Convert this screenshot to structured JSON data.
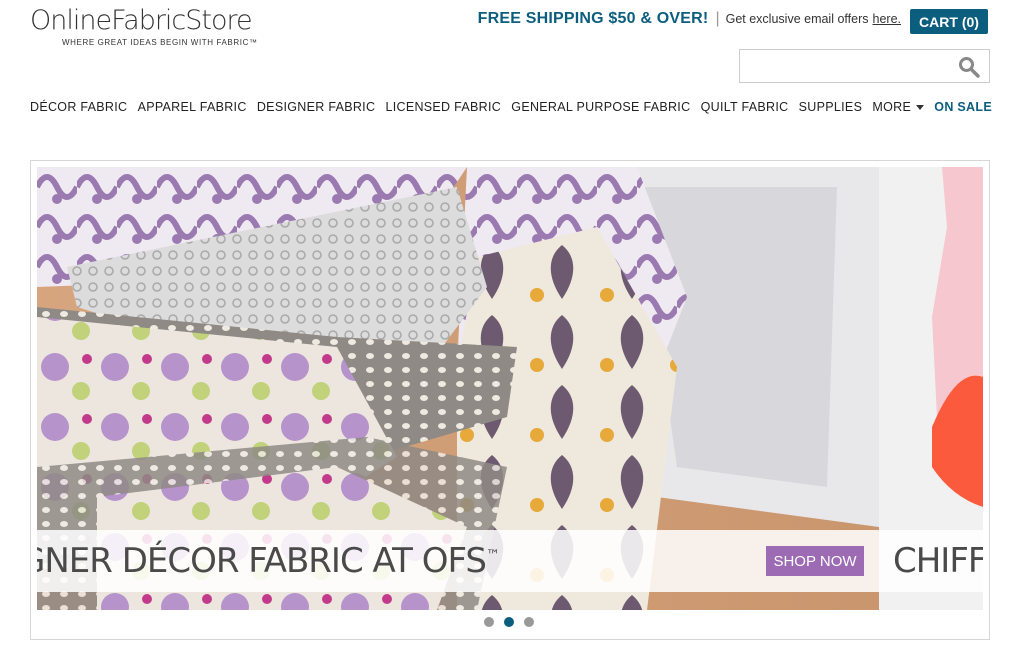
{
  "logo": {
    "name": "OnlineFabricStore",
    "tagline": "WHERE GREAT IDEAS BEGIN WITH FABRIC™"
  },
  "header": {
    "free_shipping": "FREE SHIPPING $50 & OVER!",
    "separator": "|",
    "email_offer_text": "Get exclusive email offers",
    "email_offer_link": "here.",
    "cart_label": "CART (0)"
  },
  "search": {
    "placeholder": "",
    "value": "",
    "icon": "search-icon"
  },
  "nav": {
    "items": [
      "DÉCOR FABRIC",
      "APPAREL FABRIC",
      "DESIGNER FABRIC",
      "LICENSED FABRIC",
      "GENERAL PURPOSE FABRIC",
      "QUILT FABRIC",
      "SUPPLIES",
      "MORE",
      "ON SALE"
    ]
  },
  "carousel": {
    "caption": "GNER DÉCOR FABRIC AT OFS",
    "caption_mark": "™",
    "button_label": "SHOP NOW",
    "next_caption": "CHIFF",
    "active_slide": 2,
    "slide_count": 3
  },
  "colors": {
    "brand_blue": "#0b5e7e",
    "shop_button_purple": "#9c6bb4"
  }
}
